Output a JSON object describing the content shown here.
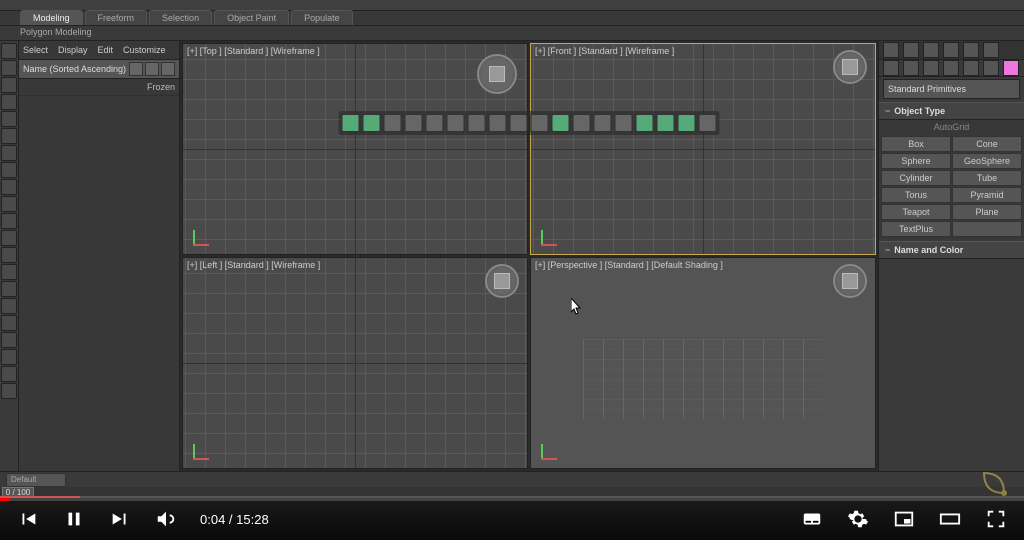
{
  "ribbon": {
    "tabs": [
      "Modeling",
      "Freeform",
      "Selection",
      "Object Paint",
      "Populate"
    ],
    "sub": "Polygon Modeling"
  },
  "scene": {
    "tabs": [
      "Select",
      "Display",
      "Edit",
      "Customize"
    ],
    "header": "Name (Sorted Ascending)",
    "col2": "Frozen"
  },
  "viewports": {
    "top": "[+] [Top ] [Standard ] [Wireframe ]",
    "front": "[+] [Front ] [Standard ] [Wireframe ]",
    "left": "[+] [Left ] [Standard ] [Wireframe ]",
    "persp": "[+] [Perspective ] [Standard ] [Default Shading ]"
  },
  "command_panel": {
    "category": "Standard Primitives",
    "rollout_type": "Object Type",
    "autogrid": "AutoGrid",
    "buttons": [
      "Box",
      "Cone",
      "Sphere",
      "GeoSphere",
      "Cylinder",
      "Tube",
      "Torus",
      "Pyramid",
      "Teapot",
      "Plane",
      "TextPlus",
      ""
    ],
    "rollout_name": "Name and Color"
  },
  "timeline": {
    "marker": "0 / 100",
    "layer": "Default"
  },
  "player": {
    "time": "0:04 / 15:28"
  }
}
